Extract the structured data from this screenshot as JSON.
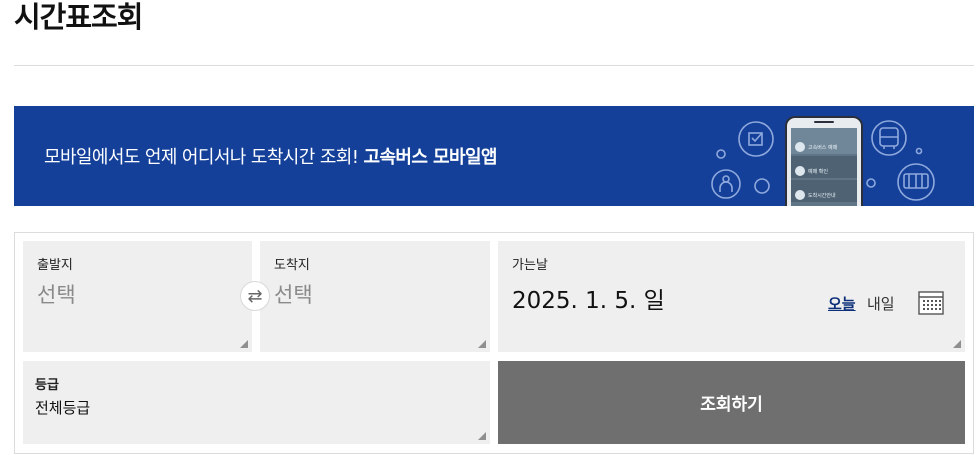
{
  "page": {
    "title": "시간표조회"
  },
  "banner": {
    "text_regular": "모바일에서도 언제 어디서나 도착시간 조회! ",
    "text_bold": "고속버스 모바일앱",
    "phone_menu": [
      "고속버스 예매",
      "예매 확인",
      "도착시간안내"
    ],
    "background": "#14409a"
  },
  "search": {
    "departure": {
      "label": "출발지",
      "value": "선택"
    },
    "arrival": {
      "label": "도착지",
      "value": "선택"
    },
    "swap_icon": "swap-arrows-icon",
    "date": {
      "label": "가는날",
      "value": "2025. 1. 5. 일",
      "today": "오늘",
      "tomorrow": "내일",
      "icon": "calendar-icon"
    },
    "grade": {
      "label": "등급",
      "value": "전체등급"
    },
    "submit": "조회하기"
  },
  "colors": {
    "accent": "#14409a",
    "button": "#6f6f6f",
    "field_bg": "#efefef",
    "link": "#0c2f7a"
  }
}
